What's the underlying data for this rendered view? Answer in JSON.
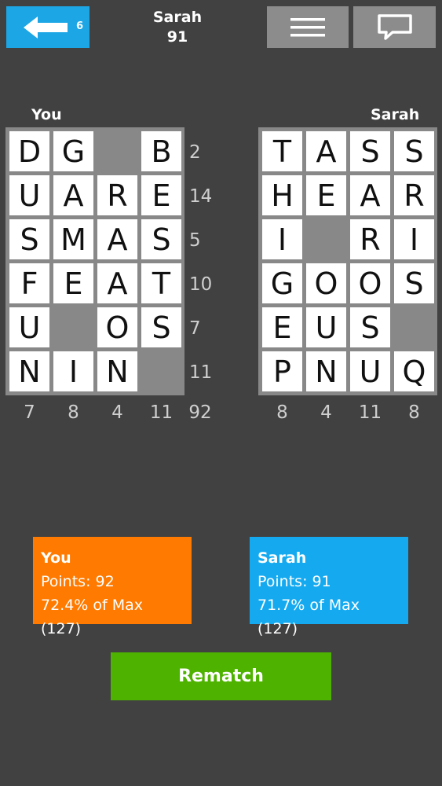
{
  "header": {
    "back_badge": "6",
    "opponent_name": "Sarah",
    "opponent_score": "91"
  },
  "boards": {
    "you": {
      "label": "You",
      "cells": [
        [
          "D",
          "G",
          "",
          "B"
        ],
        [
          "U",
          "A",
          "R",
          "E"
        ],
        [
          "S",
          "M",
          "A",
          "S"
        ],
        [
          "F",
          "E",
          "A",
          "T"
        ],
        [
          "U",
          "",
          "O",
          "S"
        ],
        [
          "N",
          "I",
          "N",
          ""
        ]
      ],
      "row_scores": [
        "2",
        "14",
        "5",
        "10",
        "7",
        "11"
      ],
      "col_scores": [
        "7",
        "8",
        "4",
        "11"
      ],
      "total": "92"
    },
    "opponent": {
      "label": "Sarah",
      "cells": [
        [
          "T",
          "A",
          "S",
          "S"
        ],
        [
          "H",
          "E",
          "A",
          "R"
        ],
        [
          "I",
          "",
          "R",
          "I"
        ],
        [
          "G",
          "O",
          "O",
          "S"
        ],
        [
          "E",
          "U",
          "S",
          ""
        ],
        [
          "P",
          "N",
          "U",
          "Q"
        ]
      ],
      "col_scores": [
        "8",
        "4",
        "11",
        "8"
      ]
    }
  },
  "results": {
    "you": {
      "name": "You",
      "points": "Points: 92",
      "percent": "72.4% of Max (127)"
    },
    "opponent": {
      "name": "Sarah",
      "points": "Points: 91",
      "percent": "71.7% of Max (127)"
    }
  },
  "rematch_label": "Rematch",
  "colors": {
    "background": "#414141",
    "back_button": "#1ca6e6",
    "toolbar_button": "#8c8c8c",
    "you_card": "#ff7a00",
    "opponent_card": "#15aaf0",
    "rematch": "#4eb200"
  },
  "icons": {
    "back": "arrow-left-icon",
    "menu": "hamburger-menu-icon",
    "chat": "chat-bubble-icon"
  }
}
